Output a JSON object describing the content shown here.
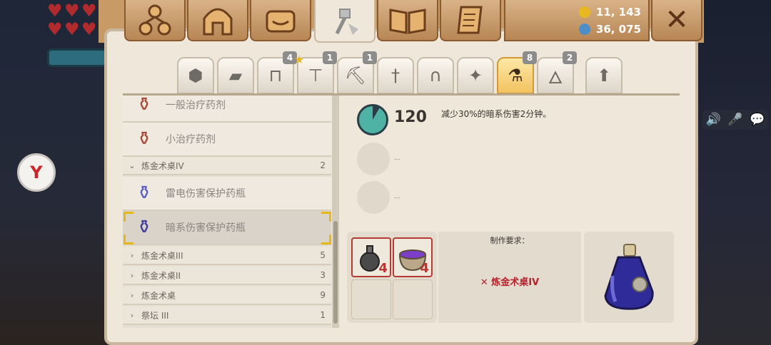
{
  "window": {
    "title": ""
  },
  "currency": {
    "gold": "11, 143",
    "gems": "36, 075",
    "gold_color": "#e8b820",
    "gem_color": "#4e8ec8"
  },
  "top_tabs": [
    {
      "name": "skills-tree-icon"
    },
    {
      "name": "helmet-icon"
    },
    {
      "name": "bag-icon"
    },
    {
      "name": "crafting-hammer-icon",
      "active": true
    },
    {
      "name": "map-book-icon"
    },
    {
      "name": "scroll-icon"
    }
  ],
  "sub_tabs": [
    {
      "icon": "block-icon",
      "badge": ""
    },
    {
      "icon": "materials-icon",
      "badge": ""
    },
    {
      "icon": "workbench-icon",
      "badge": "4"
    },
    {
      "icon": "table-icon",
      "badge": "1",
      "star": true
    },
    {
      "icon": "pickaxe-icon",
      "badge": "1"
    },
    {
      "icon": "sword-icon",
      "badge": ""
    },
    {
      "icon": "armor-helmet-icon",
      "badge": ""
    },
    {
      "icon": "sparkle-icon",
      "badge": ""
    },
    {
      "icon": "potion-flask-icon",
      "badge": "8",
      "active": true
    },
    {
      "icon": "torch-icon",
      "badge": "2"
    },
    {
      "icon": "upgrade-arrow-icon",
      "badge": ""
    }
  ],
  "recipe_list": {
    "items_top": [
      {
        "label": "一般治疗药剂"
      },
      {
        "label": "小治疗药剂"
      }
    ],
    "group_open": {
      "label": "炼金术桌IV",
      "count": "2"
    },
    "items_group": [
      {
        "label": "雷电伤害保护药瓶"
      },
      {
        "label": "暗系伤害保护药瓶",
        "selected": true
      }
    ],
    "groups_closed": [
      {
        "label": "炼金术桌III",
        "count": "5"
      },
      {
        "label": "炼金术桌II",
        "count": "3"
      },
      {
        "label": "炼金术桌",
        "count": "9"
      },
      {
        "label": "祭坛 III",
        "count": "1"
      }
    ]
  },
  "detail": {
    "duration": "120",
    "effect": "减少30%的暗系伤害2分钟。",
    "empty_slots": [
      "--",
      "--"
    ]
  },
  "ingredients": [
    {
      "icon": "bomb-flask-icon",
      "count": "4"
    },
    {
      "icon": "purple-cauldron-icon",
      "count": "4"
    }
  ],
  "requirements": {
    "title": "制作要求：",
    "item": "炼金术桌IV",
    "mark": "✕"
  },
  "hud": {
    "hearts": 6
  }
}
